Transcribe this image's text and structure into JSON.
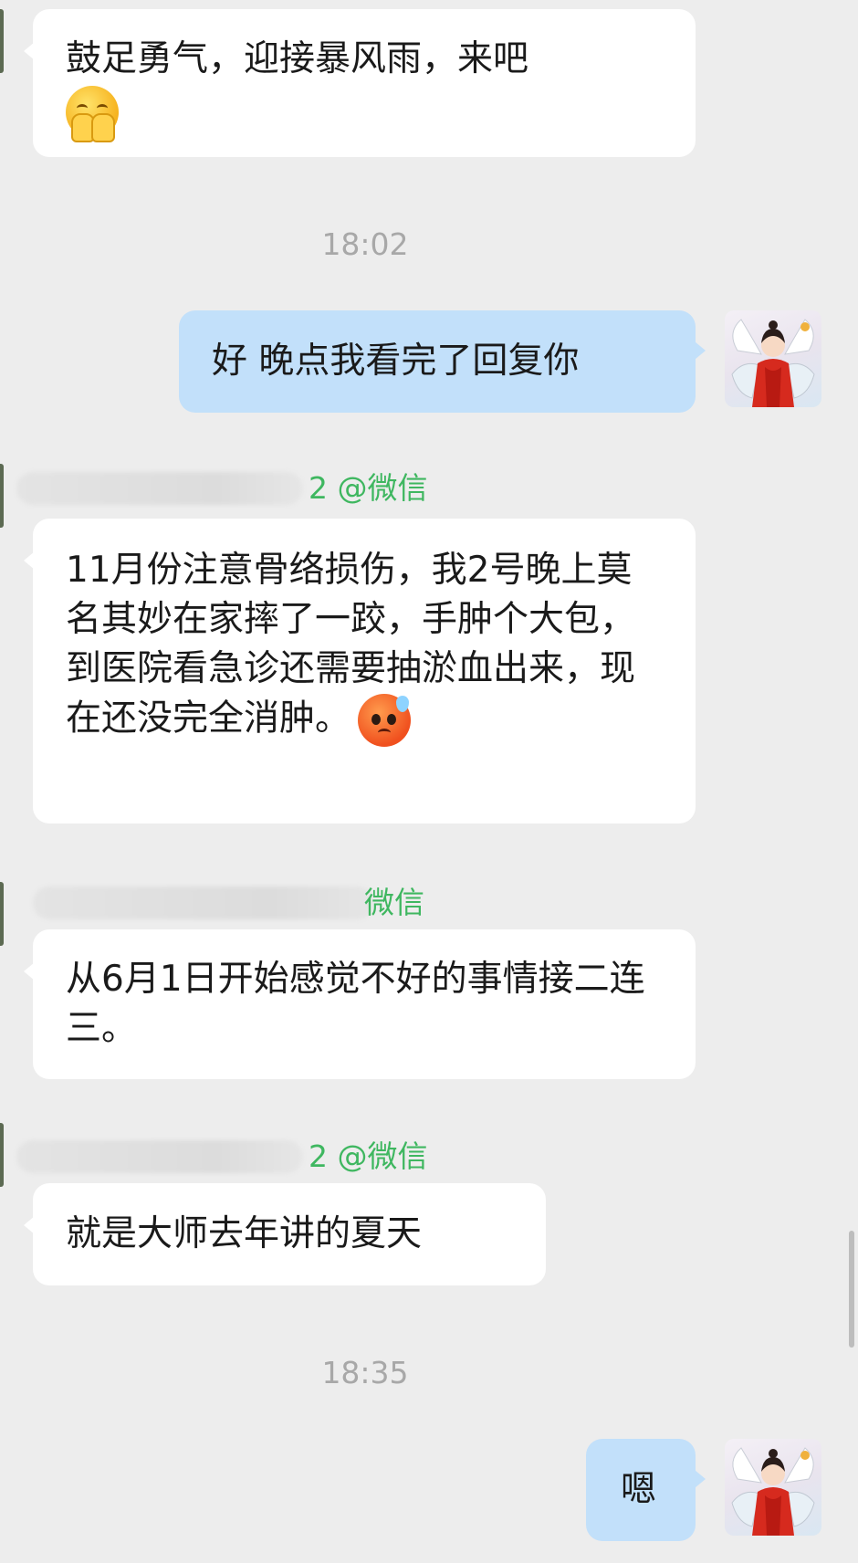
{
  "messages": [
    {
      "type": "incoming",
      "text": "鼓足勇气，迎接暴风雨，来吧",
      "emoji": "hands-over-mouth-emoji"
    },
    {
      "type": "timestamp",
      "text": "18:02"
    },
    {
      "type": "outgoing",
      "text": "好 晚点我看完了回复你",
      "avatar": "avatar-angel-in-red"
    },
    {
      "type": "incoming",
      "sender_visible": "2 @微信",
      "text": "11月份注意骨络损伤，我2号晚上莫名其妙在家摔了一跤，手肿个大包，到医院看急诊还需要抽淤血出来，现在还没完全消肿。",
      "emoji": "sweat-face-emoji"
    },
    {
      "type": "incoming",
      "sender_visible": "微信",
      "text": "从6月1日开始感觉不好的事情接二连三。"
    },
    {
      "type": "incoming",
      "sender_visible": "2 @微信",
      "text": "就是大师去年讲的夏天"
    },
    {
      "type": "timestamp",
      "text": "18:35"
    },
    {
      "type": "outgoing",
      "text": "嗯",
      "avatar": "avatar-angel-in-red"
    }
  ],
  "colors": {
    "background": "#ededed",
    "incoming_bubble": "#ffffff",
    "outgoing_bubble": "#c2e0fa",
    "wechat_tag": "#3fb760",
    "timestamp_text": "#a8a8a8"
  }
}
